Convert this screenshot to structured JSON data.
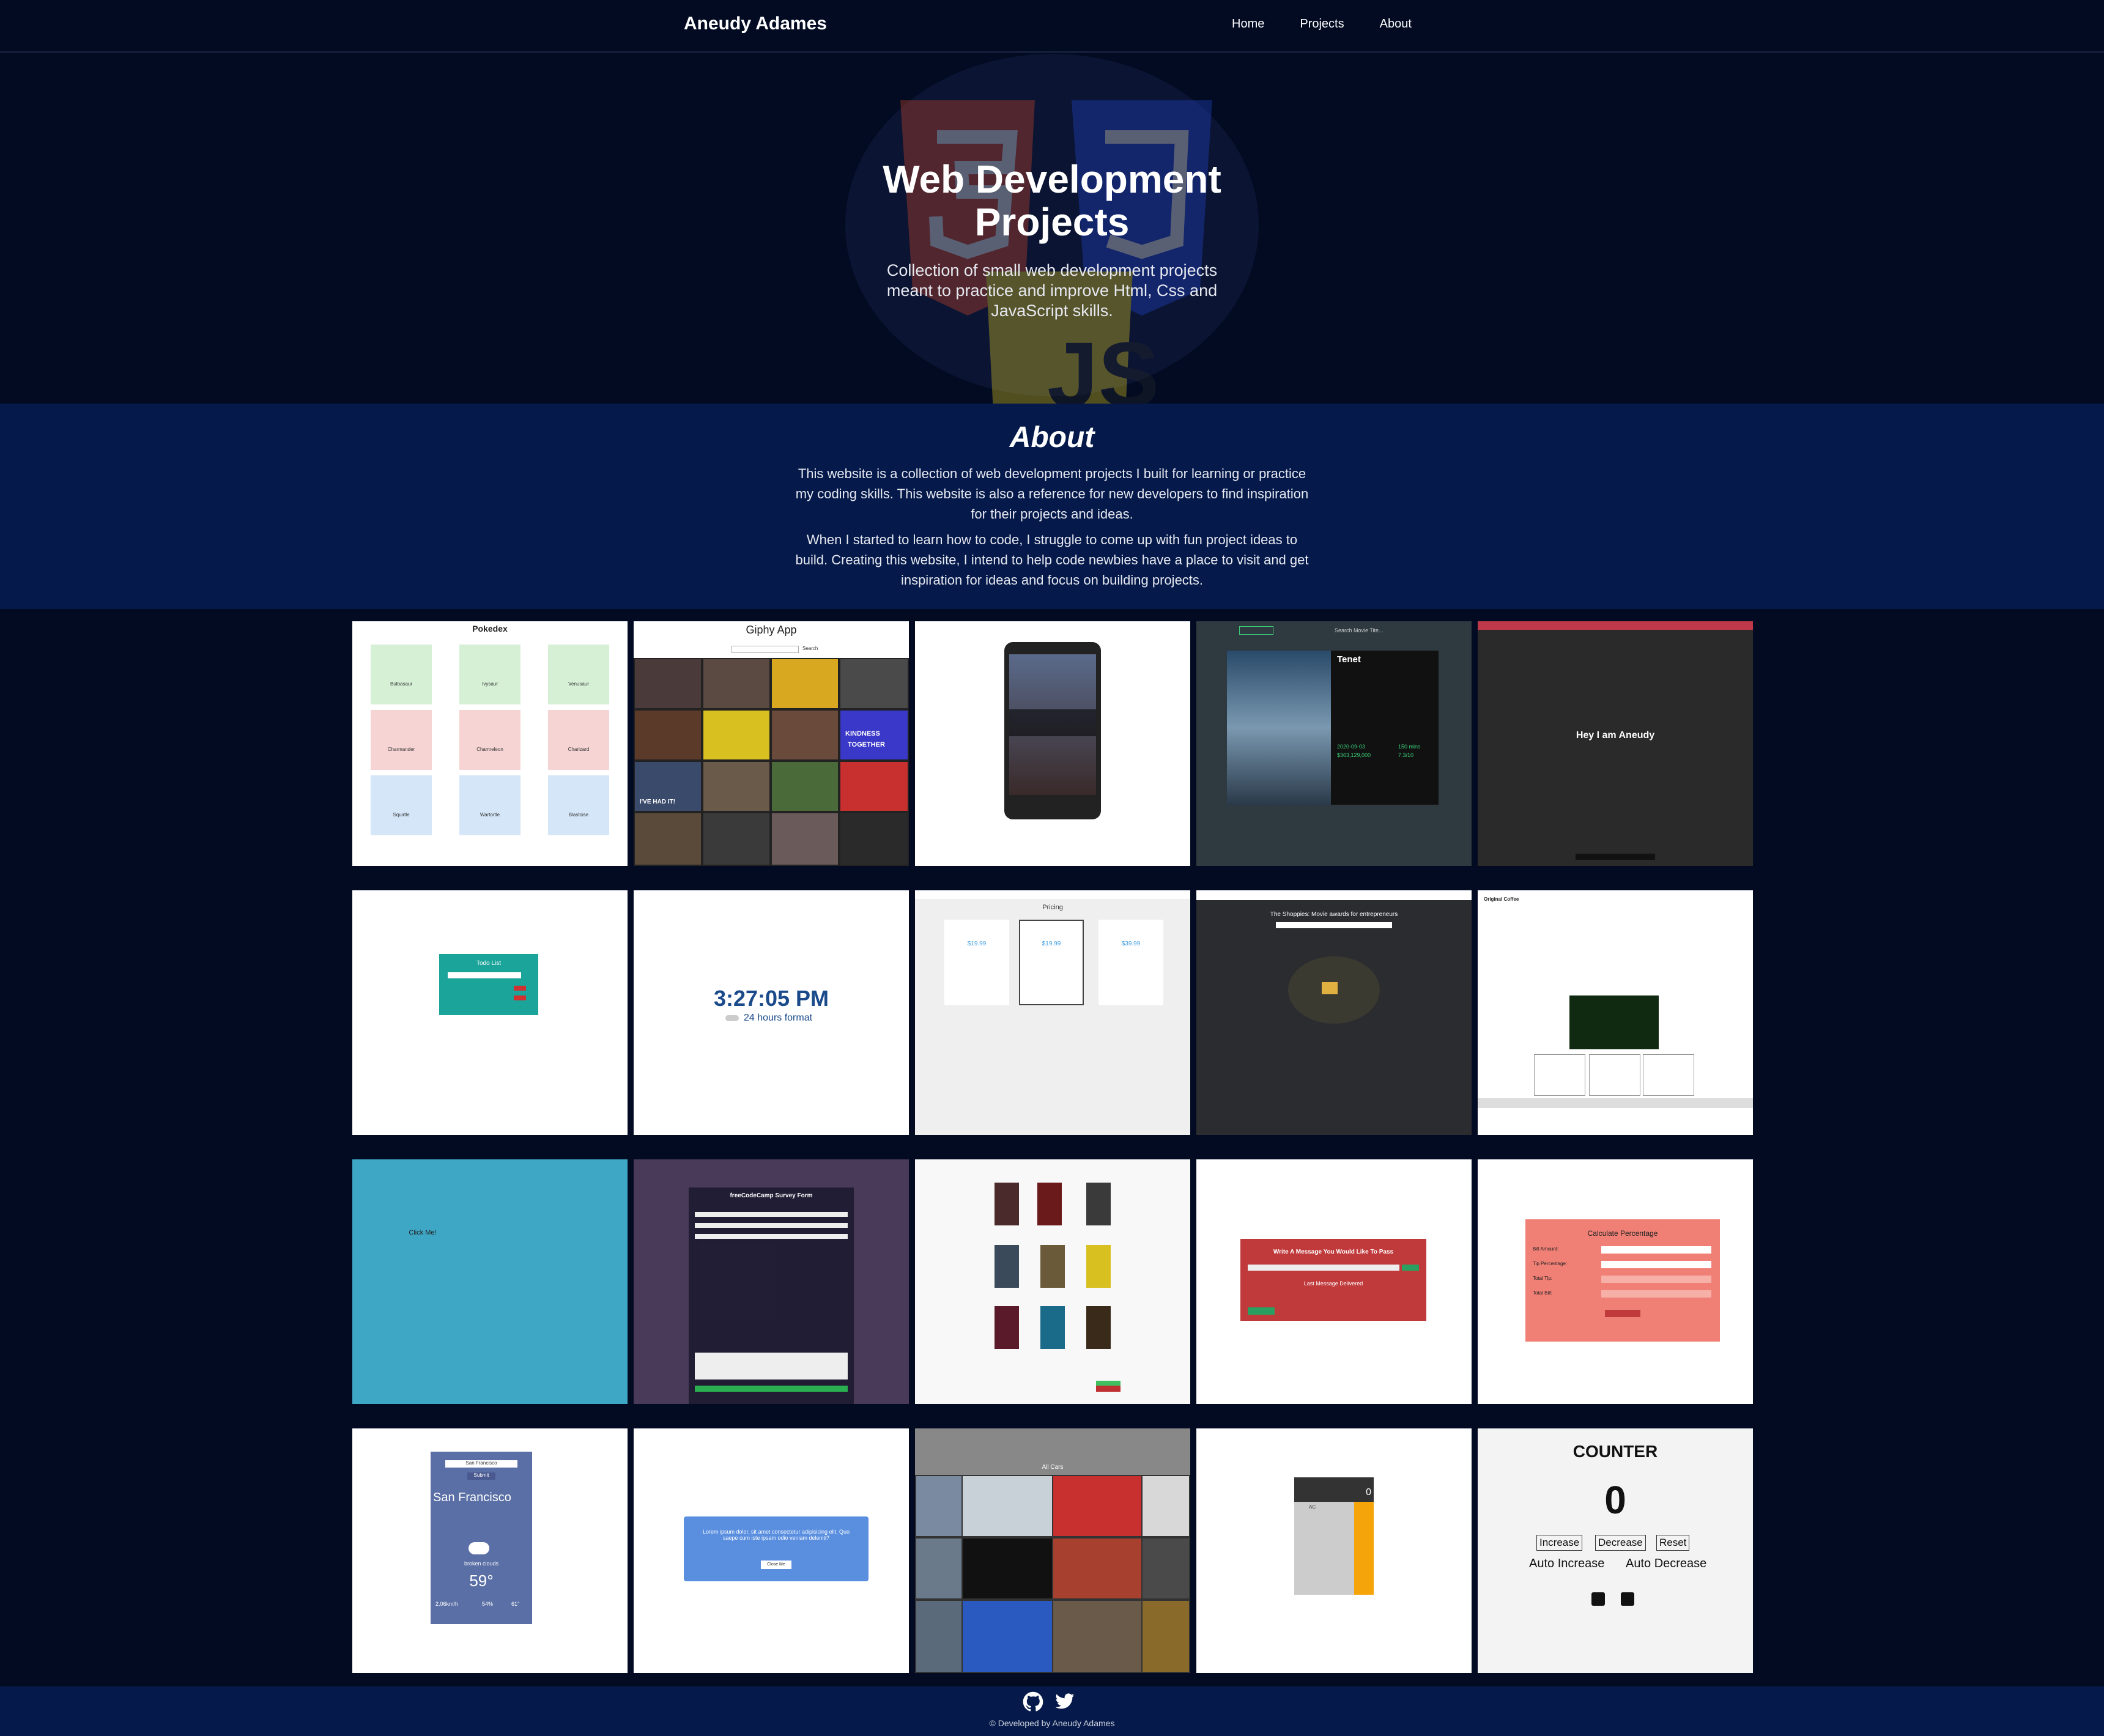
{
  "nav": {
    "brand": "Aneudy Adames",
    "links": [
      "Home",
      "Projects",
      "About"
    ]
  },
  "hero": {
    "title_line1": "Web Development",
    "title_line2": "Projects",
    "subtitle": "Collection of small web development projects meant to practice and improve Html, Css and JavaScript skills."
  },
  "about": {
    "heading": "About",
    "p1": "This website is a collection of web development projects I built for learning or practice my coding skills. This website is also a reference for new developers to find inspiration for their projects and ideas.",
    "p2": "When I started to learn how to code, I struggle to come up with fun project ideas to build. Creating this website, I intend to help code newbies have a place to visit and get inspiration for ideas and focus on building projects."
  },
  "projects": {
    "pokedex": {
      "title": "Pokedex",
      "names": [
        "Bulbasaur",
        "Ivysaur",
        "Venusaur",
        "Charmander",
        "Charmeleon",
        "Charizard",
        "Squirtle",
        "Wartortle",
        "Blastoise"
      ]
    },
    "giphy": {
      "title": "Giphy App",
      "search": "Search",
      "captions": [
        "KINDNESS",
        "TOGETHER",
        "I'VE HAD IT!"
      ]
    },
    "tenet": {
      "title": "Tenet",
      "search": "Search Movie Tite...",
      "date": "2020-09-03",
      "money": "$363,129,000",
      "runtime": "150 mins",
      "rating": "7.3/10"
    },
    "hey": {
      "title": "Hey I am Aneudy"
    },
    "todo": {
      "title": "Todo List"
    },
    "clock": {
      "time": "3:27:05 PM",
      "format": "24 hours format"
    },
    "pricing": {
      "title": "Pricing",
      "prices": [
        "$19.99",
        "$19.99",
        "$39.99"
      ]
    },
    "shoppies": {
      "title": "The Shoppies: Movie awards for entrepreneurs"
    },
    "original": {
      "title": "Original Coffee"
    },
    "click": {
      "label": "Click Me!"
    },
    "survey": {
      "title": "freeCodeCamp Survey Form"
    },
    "message": {
      "title": "Write A Message You Would Like To Pass",
      "last": "Last Message Delivered"
    },
    "percentage": {
      "title": "Calculate Percentage",
      "labels": [
        "Bill Amount:",
        "Tip Percentage:",
        "Total Tip:",
        "Total Bill:"
      ]
    },
    "weather": {
      "city_input": "San Francisco",
      "submit": "Submit",
      "city": "San Francisco",
      "desc": "broken clouds",
      "temp": "59°",
      "stats": [
        "2.06km/h",
        "54%",
        "61°"
      ]
    },
    "modal": {
      "text": "Lorem ipsum dolor, sit amet consectetur adipisicing elit. Quo saepe cum iste ipsam odio veniam deleniti?",
      "close": "Close Me"
    },
    "cars": {
      "title": "All Cars"
    },
    "calculator": {
      "display": "0",
      "ac": "AC"
    },
    "counter": {
      "title": "COUNTER",
      "value": "0",
      "buttons": [
        "Increase",
        "Decrease",
        "Reset"
      ],
      "auto_inc": "Auto Increase",
      "auto_dec": "Auto Decrease"
    }
  },
  "footer": {
    "text": "© Developed by Aneudy Adames"
  },
  "colors": {
    "bg": "#020b22",
    "about_bg": "#051a4a",
    "teal": "#1aa49a",
    "coral": "#f08076",
    "red": "#c0393b",
    "sky": "#3ea7c6"
  }
}
